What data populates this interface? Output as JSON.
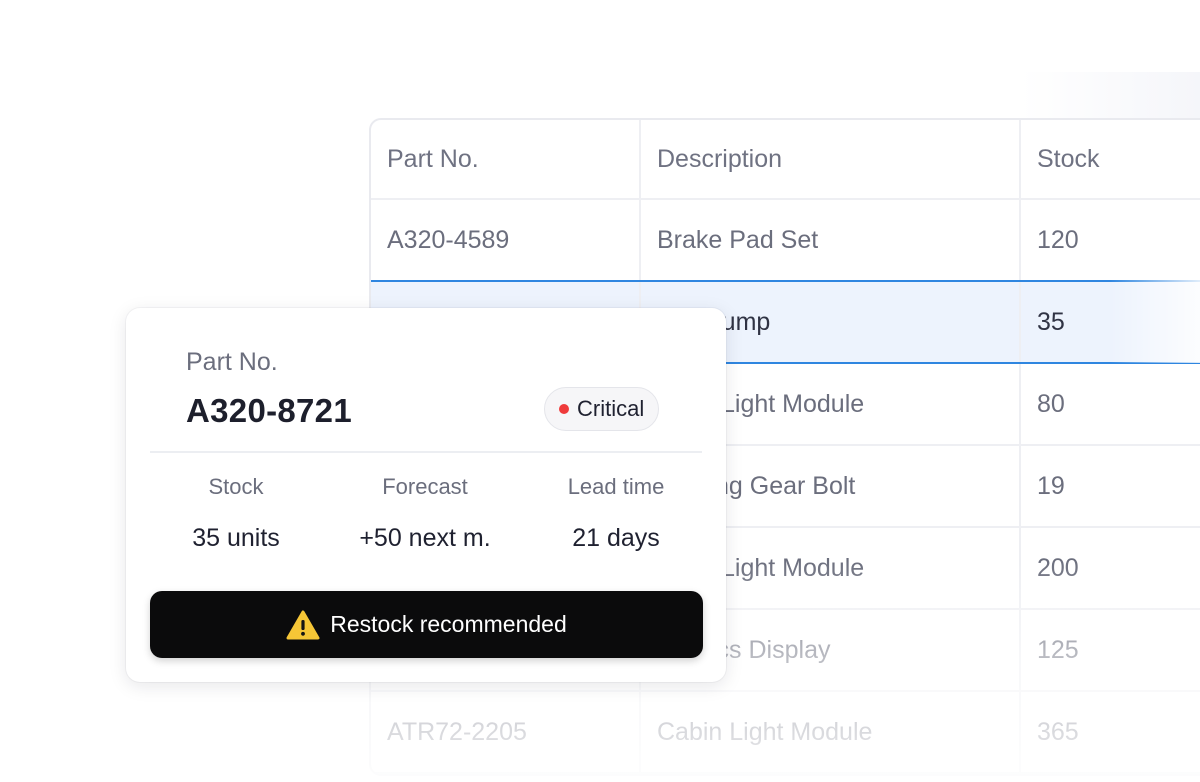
{
  "table": {
    "columns": [
      "Part No.",
      "Description",
      "Stock"
    ],
    "rows": [
      {
        "part": "A320-4589",
        "description": "Brake Pad Set",
        "stock": "120"
      },
      {
        "part": "",
        "description": "Pump",
        "stock": "35",
        "selected": true
      },
      {
        "part": "",
        "description": "Light Module",
        "stock": "80"
      },
      {
        "part": "",
        "description": "ng Gear Bolt",
        "stock": "19"
      },
      {
        "part": "",
        "description": "Light Module",
        "stock": "200"
      },
      {
        "part": "",
        "description": "ics Display",
        "stock": "125"
      },
      {
        "part": "ATR72-2205",
        "description": "Cabin Light Module",
        "stock": "365"
      }
    ]
  },
  "card": {
    "label": "Part No.",
    "part_number": "A320-8721",
    "badge": "Critical",
    "stats": [
      {
        "label": "Stock",
        "value": "35 units"
      },
      {
        "label": "Forecast",
        "value": "+50 next m."
      },
      {
        "label": "Lead time",
        "value": "21 days"
      }
    ],
    "action_label": "Restock recommended"
  },
  "colors": {
    "accent": "#2f86e0",
    "selected_row": "#edf3fd",
    "critical": "#ef3b3b",
    "warning": "#f6c636",
    "button": "#0b0b0c"
  },
  "icons": {
    "status": "status-dot-icon",
    "warning": "warning-triangle-icon"
  }
}
